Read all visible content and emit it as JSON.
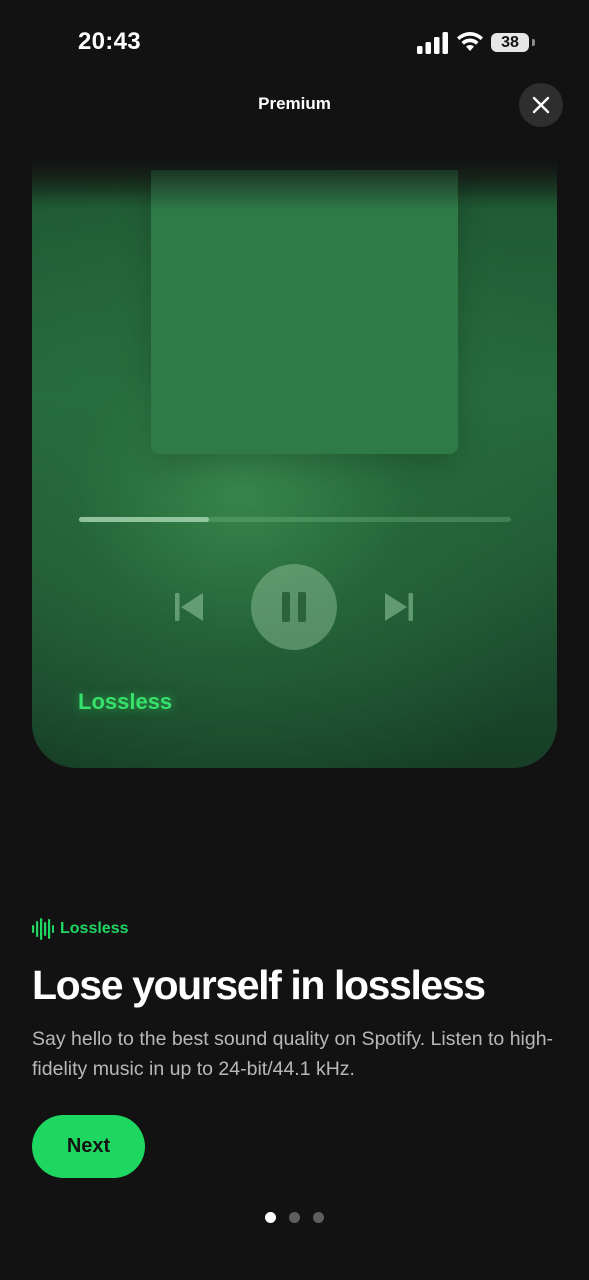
{
  "status_bar": {
    "time": "20:43",
    "battery": "38",
    "icons": [
      "signal-icon",
      "wifi-icon",
      "battery-icon"
    ]
  },
  "header": {
    "title": "Premium",
    "close_icon": "close-icon"
  },
  "hero": {
    "label": "Lossless",
    "progress_fraction": 0.3,
    "controls": [
      "previous-icon",
      "pause-icon",
      "next-track-icon"
    ]
  },
  "feature": {
    "tag_icon": "waveform-icon",
    "tag_label": "Lossless",
    "headline": "Lose yourself in lossless",
    "body": "Say hello to the best sound quality on Spotify. Listen to high-fidelity music in up to 24-bit/44.1 kHz."
  },
  "actions": {
    "next_label": "Next"
  },
  "pagination": {
    "total": 3,
    "current": 1
  },
  "colors": {
    "accent": "#1ed760",
    "background": "#121212",
    "hero_label": "#36e06a"
  }
}
